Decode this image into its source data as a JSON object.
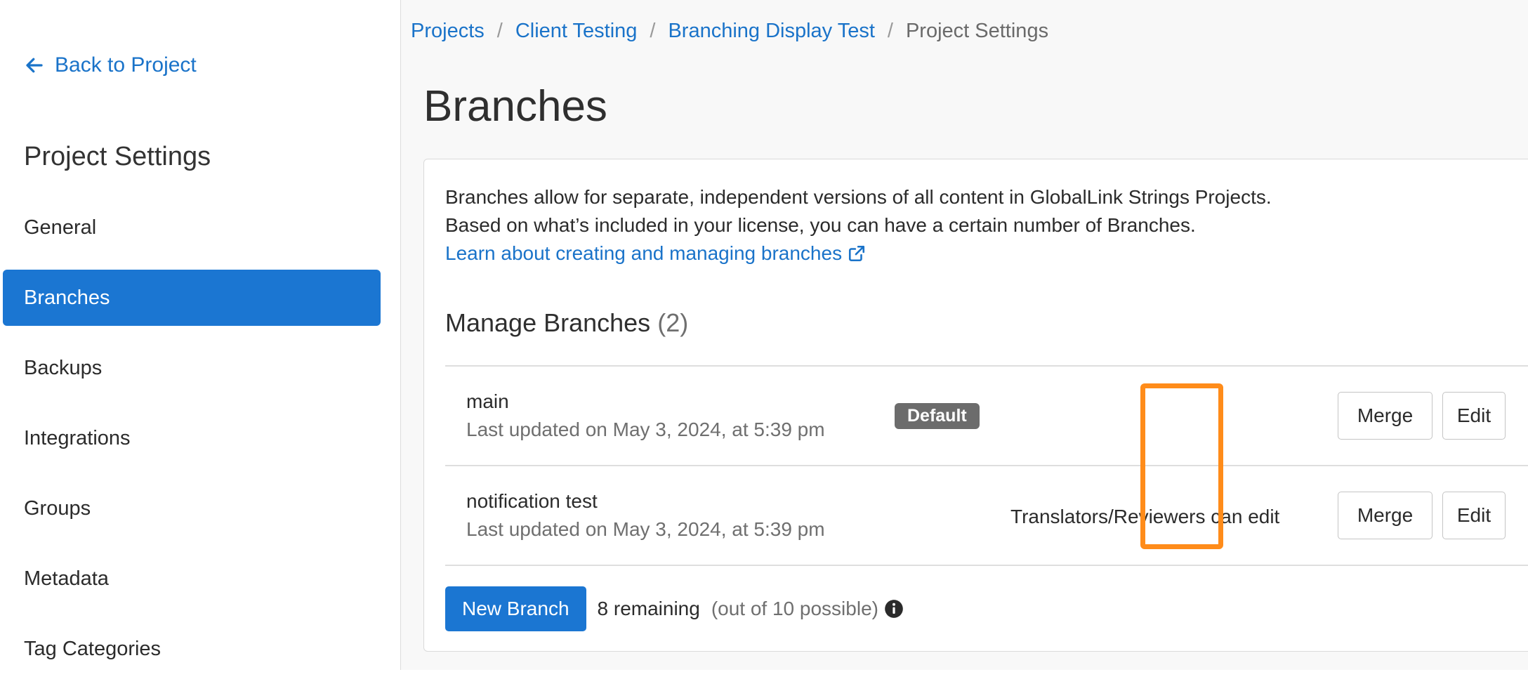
{
  "sidebar": {
    "back_label": "Back to Project",
    "title": "Project Settings",
    "items": [
      {
        "label": "General"
      },
      {
        "label": "Branches"
      },
      {
        "label": "Backups"
      },
      {
        "label": "Integrations"
      },
      {
        "label": "Groups"
      },
      {
        "label": "Metadata"
      },
      {
        "label": "Tag Categories"
      }
    ],
    "active_item": "Branches"
  },
  "breadcrumb": {
    "items": [
      "Projects",
      "Client Testing",
      "Branching Display Test"
    ],
    "separator": "/",
    "current": "Project Settings"
  },
  "page": {
    "title": "Branches"
  },
  "card": {
    "description_line1": "Branches allow for separate, independent versions of all content in GlobalLink Strings Projects.",
    "description_line2": "Based on what’s included in your license, you can have a certain number of Branches.",
    "learn_link": "Learn about creating and managing branches",
    "manage_title": "Manage Branches",
    "manage_count": "(2)"
  },
  "branches": [
    {
      "name": "main",
      "updated": "Last updated on May 3, 2024, at 5:39 pm",
      "badge": "Default",
      "merge_label": "Merge",
      "edit_label": "Edit"
    },
    {
      "name": "notification test",
      "updated": "Last updated on May 3, 2024, at 5:39 pm",
      "permission": "Translators/Reviewers can edit",
      "merge_label": "Merge",
      "edit_label": "Edit"
    }
  ],
  "footer": {
    "new_branch_label": "New Branch",
    "remaining": "8 remaining",
    "possible": "(out of 10 possible)"
  },
  "colors": {
    "accent": "#1b76d2",
    "link": "#1a73c9",
    "highlight": "#ff8c1a",
    "badge": "#6c6c6c"
  }
}
